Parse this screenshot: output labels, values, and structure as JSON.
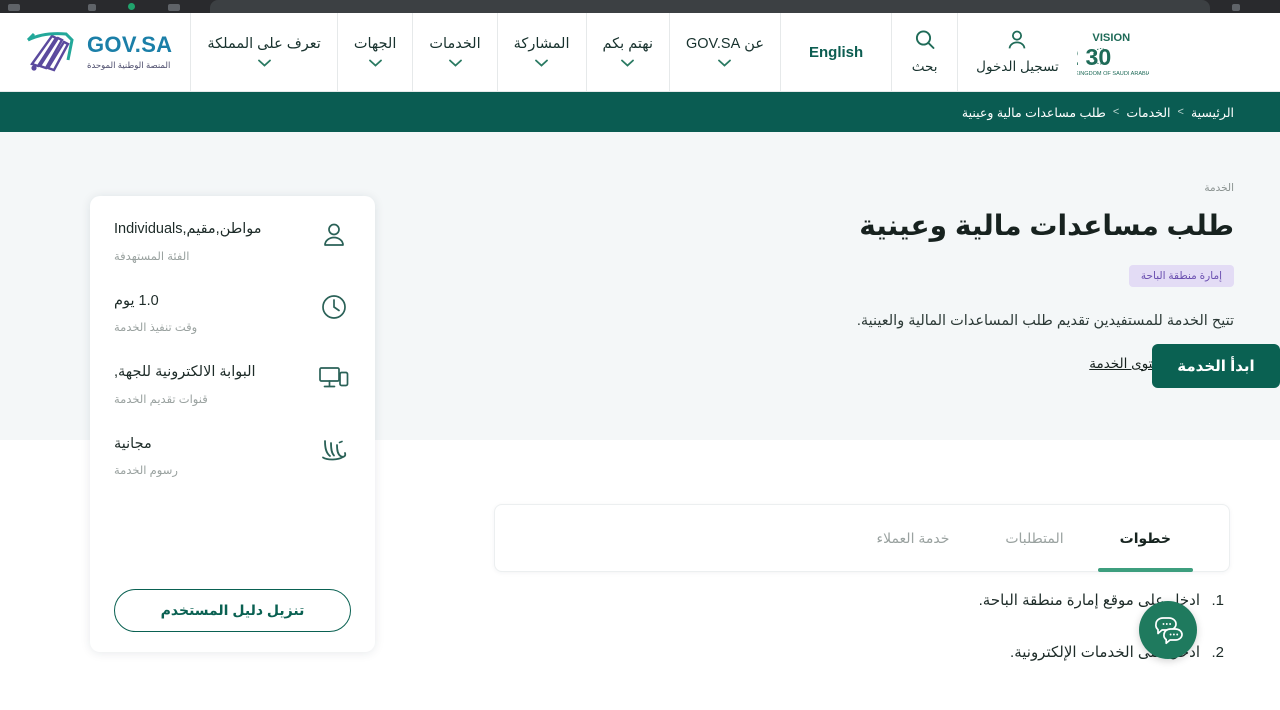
{
  "browser": {
    "chrome_visible": true
  },
  "topnav": {
    "brand": {
      "title": "GOV.SA",
      "subtitle": "المنصة الوطنية الموحدة",
      "icon": "govsa-mark-icon"
    },
    "menu": [
      {
        "label": "تعرف على المملكة",
        "has_chevron": true
      },
      {
        "label": "الجهات",
        "has_chevron": true
      },
      {
        "label": "الخدمات",
        "has_chevron": true
      },
      {
        "label": "المشاركة",
        "has_chevron": true
      },
      {
        "label": "نهتم بكم",
        "has_chevron": true
      },
      {
        "label": "عن GOV.SA",
        "has_chevron": true
      }
    ],
    "language_switch": "English",
    "search": {
      "label": "بحث",
      "icon": "search-icon"
    },
    "login": {
      "label": "تسجيل الدخول",
      "icon": "user-icon"
    },
    "vision_logo": {
      "title": "VISION 2030",
      "alt": "رؤية المملكة العربية السعودية 2030"
    }
  },
  "breadcrumb": {
    "items": [
      {
        "label": "الرئيسية",
        "current": false
      },
      {
        "label": "الخدمات",
        "current": false
      },
      {
        "label": "طلب مساعدات مالية وعينية",
        "current": true
      }
    ],
    "separator": ">"
  },
  "hero": {
    "eyebrow": "الخدمة",
    "title": "طلب مساعدات مالية وعينية",
    "badge": "إمارة منطقة الباحة",
    "description": "تتيح الخدمة للمستفيدين تقديم طلب المساعدات المالية والعينية.",
    "sla_link": {
      "label": "اتفاقية مستوى الخدمة",
      "icon": "external-link-icon"
    },
    "start_button": "ابدأ الخدمة"
  },
  "info_card": {
    "rows": [
      {
        "icon": "user-icon",
        "value": "مواطن,مقيم,Individuals",
        "label": "الفئة المستهدفة"
      },
      {
        "icon": "clock-icon",
        "value": "1.0 يوم",
        "label": "وقت تنفيذ الخدمة"
      },
      {
        "icon": "devices-icon",
        "value": "البوابة الالكترونية للجهة,",
        "label": "قنوات تقديم الخدمة"
      },
      {
        "icon": "riyal-icon",
        "value": "مجانية",
        "label": "رسوم الخدمة"
      }
    ],
    "guide_button": "تنزيل دليل المستخدم"
  },
  "tabs": [
    {
      "label": "خطوات",
      "active": true
    },
    {
      "label": "المتطلبات",
      "active": false
    },
    {
      "label": "خدمة العملاء",
      "active": false
    }
  ],
  "steps": [
    {
      "num": "1.",
      "text": "ادخل على موقع إمارة منطقة الباحة."
    },
    {
      "num": "2.",
      "text": "ادخل على الخدمات الإلكترونية."
    }
  ],
  "chat_widget": {
    "icon": "chat-bubbles-icon",
    "color": "#1f7a5e"
  },
  "colors": {
    "brand_teal": "#0a5c52",
    "button_green": "#0a6152",
    "tab_underline": "#3d9e7e",
    "badge_bg": "#e3dcf5",
    "badge_text": "#6a4fb0",
    "hero_bg": "#f4f7f8"
  }
}
